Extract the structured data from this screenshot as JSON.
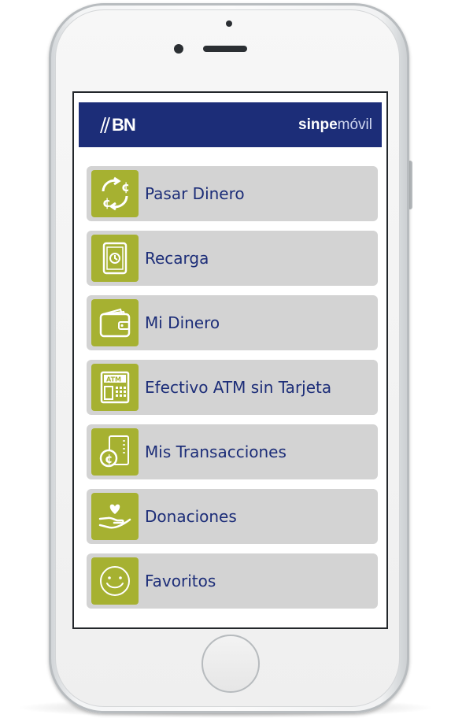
{
  "header": {
    "bank_logo_text": "BN",
    "brand_bold": "sinpe",
    "brand_light": "móvil"
  },
  "menu": {
    "items": [
      {
        "label": "Pasar Dinero",
        "icon": "transfer-colones-icon"
      },
      {
        "label": "Recarga",
        "icon": "phone-recharge-icon"
      },
      {
        "label": "Mi Dinero",
        "icon": "wallet-icon"
      },
      {
        "label": "Efectivo ATM sin Tarjeta",
        "icon": "atm-icon"
      },
      {
        "label": "Mis Transacciones",
        "icon": "transactions-icon"
      },
      {
        "label": "Donaciones",
        "icon": "donation-hand-heart-icon"
      },
      {
        "label": "Favoritos",
        "icon": "smiley-icon"
      }
    ]
  },
  "colors": {
    "header_bg": "#1c2d78",
    "icon_bg": "#a6b131",
    "item_bg": "#d3d3d3",
    "label_text": "#1c2d78"
  }
}
